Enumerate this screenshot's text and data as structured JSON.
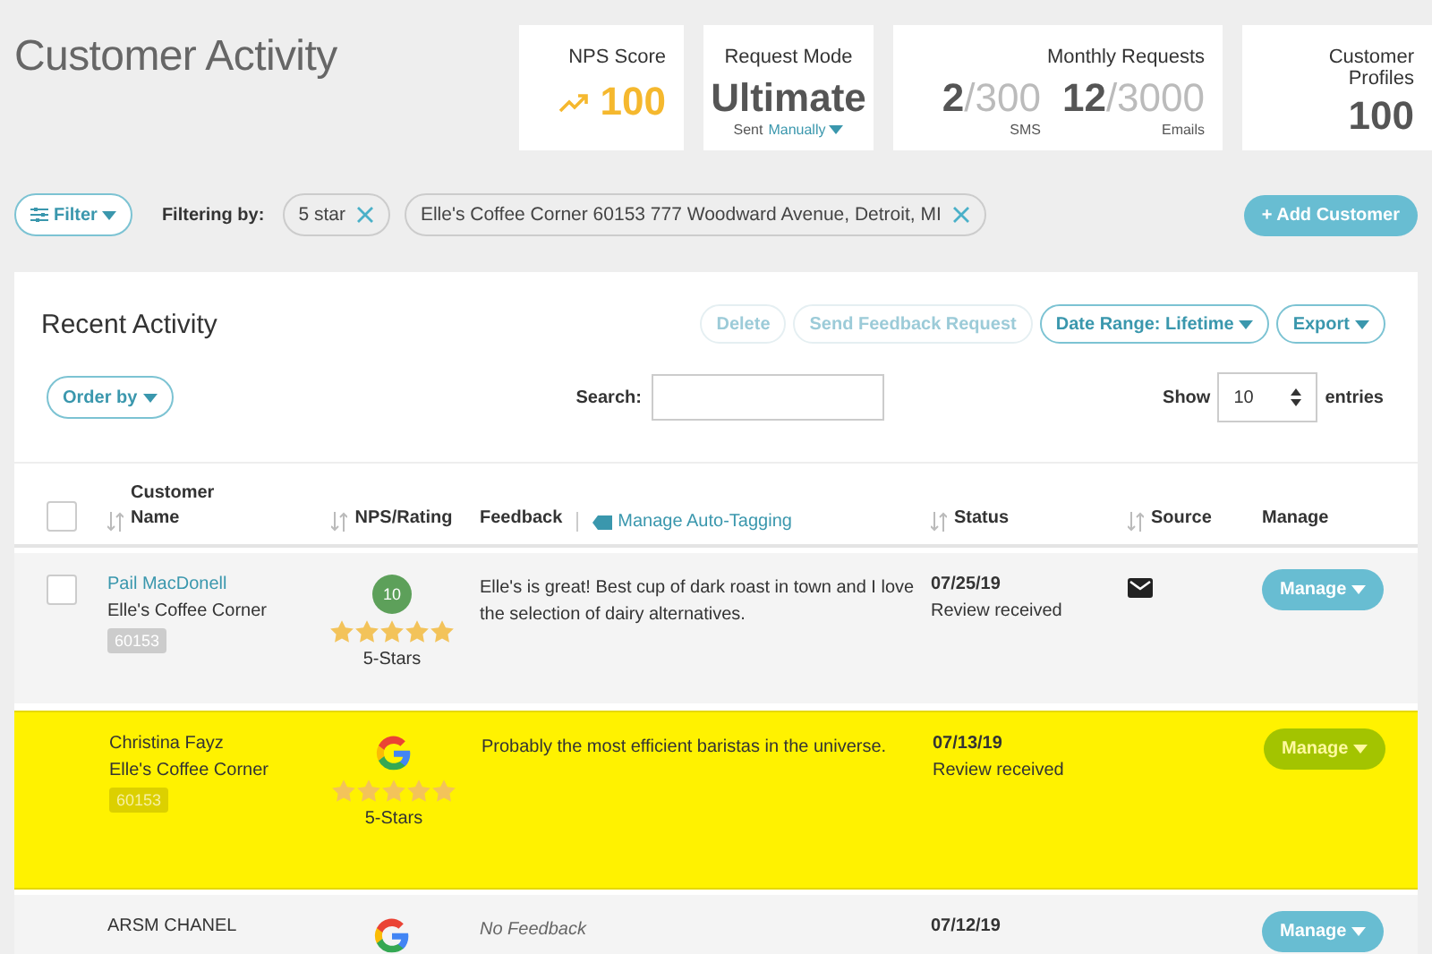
{
  "page_title": "Customer Activity",
  "stats": [
    {
      "kind": "trend",
      "label": "NPS Score",
      "value": "100"
    },
    {
      "kind": "mode",
      "label": "Request Mode",
      "value": "Ultimate",
      "note": "Sent",
      "link": "Manually"
    },
    {
      "kind": "quota",
      "label": "Monthly Requests",
      "items": [
        {
          "used": "2",
          "total": "/300",
          "unit": "SMS"
        },
        {
          "used": "12",
          "total": "/3000",
          "unit": "Emails"
        }
      ]
    },
    {
      "kind": "plain",
      "label": "Customer Profiles",
      "value": "100"
    }
  ],
  "filter_button": "Filter",
  "filtering_label": "Filtering by:",
  "filters": [
    "5 star",
    "Elle's Coffee Corner 60153 777 Woodward Avenue, Detroit, MI"
  ],
  "add_button": "+ Add Customer",
  "panel": {
    "title": "Recent Activity",
    "actions": [
      {
        "label": "Delete",
        "disabled": true,
        "caret": false
      },
      {
        "label": "Send Feedback Request",
        "disabled": true,
        "caret": false
      },
      {
        "label": "Date Range: Lifetime",
        "disabled": false,
        "caret": true
      },
      {
        "label": "Export",
        "disabled": false,
        "caret": true
      }
    ],
    "order_by": "Order by",
    "search_label": "Search:",
    "show_label": "Show",
    "entries_value": "10",
    "entries_label": "entries",
    "select_all": {
      "checked": false
    },
    "columns": [
      {
        "label": "Customer Name",
        "sortable": true
      },
      {
        "label": "NPS/Rating",
        "sortable": true
      },
      {
        "label": "Feedback",
        "sortable": false,
        "link": "Manage Auto-Tagging"
      },
      {
        "label": "Status",
        "sortable": true
      },
      {
        "label": "Source",
        "sortable": true
      },
      {
        "label": "Manage",
        "sortable": false
      }
    ],
    "rows": [
      {
        "checkbox": {
          "checked": false
        },
        "highlighted": false,
        "name": "Pail MacDonell",
        "name_link": true,
        "business": "Elle's Coffee Corner",
        "code": "60153",
        "rating": {
          "kind": "nps",
          "value": "10"
        },
        "stars": 5,
        "stars_label": "5-Stars",
        "feedback": {
          "kind": "text",
          "text": "Elle's is great! Best cup of dark roast in town and I love the selection of dairy alternatives."
        },
        "date": "07/25/19",
        "status": "Review received",
        "source": {
          "kind": "email"
        },
        "manage": "Manage"
      },
      {
        "highlighted": true,
        "name": "Christina Fayz",
        "name_link": false,
        "business": "Elle's Coffee Corner",
        "code": "60153",
        "rating": {
          "kind": "google"
        },
        "stars": 5,
        "stars_label": "5-Stars",
        "feedback": {
          "kind": "text",
          "text": "Probably the most efficient baristas in the universe."
        },
        "date": "07/13/19",
        "status": "Review received",
        "manage": "Manage"
      },
      {
        "highlighted": false,
        "name": "ARSM CHANEL",
        "name_link": false,
        "rating": {
          "kind": "google"
        },
        "feedback": {
          "kind": "empty",
          "text": "No Feedback"
        },
        "date": "07/12/19",
        "manage": "Manage"
      }
    ]
  }
}
